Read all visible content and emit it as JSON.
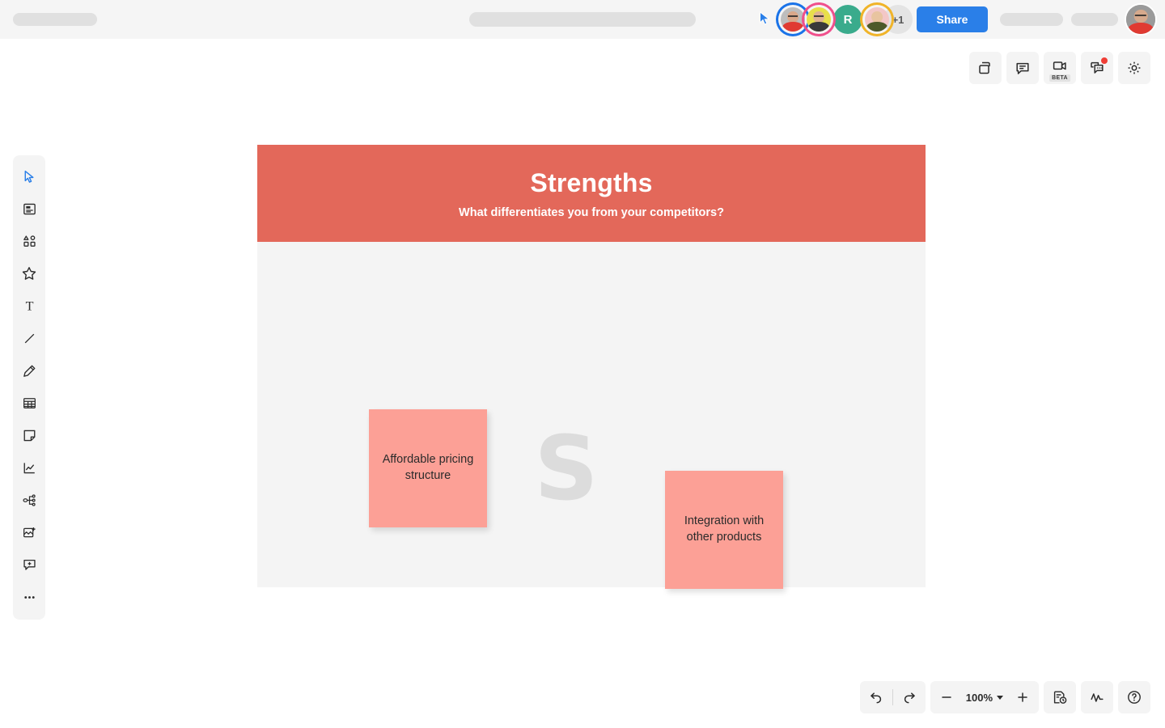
{
  "app": {
    "accent_blue": "#2a7fe8",
    "frame_header_color": "#e3685a",
    "sticky_note_color": "#fca096",
    "canvas_bg": "#f4f4f4",
    "watermark_color": "#dcdcdc"
  },
  "topbar": {
    "share_label": "Share",
    "collaborators": [
      {
        "name": "collaborator-1",
        "type": "photo",
        "ring": "#1a73e8",
        "skin": "#d9a88a",
        "shirt": "#e03a32",
        "hair": "#2b2b2b"
      },
      {
        "name": "collaborator-2",
        "type": "photo",
        "ring": "#f0508c",
        "skin": "#e0b38f",
        "shirt": "#3a3a3a",
        "hair": "#3b2a20"
      },
      {
        "name": "collaborator-3",
        "type": "initial",
        "initial": "R",
        "bg": "#3aab8c"
      },
      {
        "name": "collaborator-4",
        "type": "photo",
        "ring": "#f0b429",
        "skin": "#e8c4a0",
        "shirt": "#4d5a2a",
        "hair": "#4a3525"
      }
    ],
    "overflow_label": "+1",
    "current_user": {
      "name": "current-user-avatar",
      "skin": "#d6a98c",
      "shirt": "#e03a32",
      "bg": "#8d8d8d"
    }
  },
  "top_toolbar": [
    {
      "name": "frames-icon",
      "label": "Frames",
      "badge": null,
      "tag": null
    },
    {
      "name": "comment-icon",
      "label": "Comments",
      "badge": null,
      "tag": null
    },
    {
      "name": "video-chat-icon",
      "label": "Video chat",
      "badge": null,
      "tag": "BETA"
    },
    {
      "name": "chat-icon",
      "label": "Chat",
      "badge": "notification",
      "tag": null
    },
    {
      "name": "gear-icon",
      "label": "Settings",
      "badge": null,
      "tag": null
    }
  ],
  "sidebar": {
    "items": [
      {
        "name": "select-tool",
        "label": "Select",
        "active": true
      },
      {
        "name": "templates-tool",
        "label": "Templates",
        "active": false
      },
      {
        "name": "shapes-tool",
        "label": "Shapes",
        "active": false
      },
      {
        "name": "icons-tool",
        "label": "Icons",
        "active": false
      },
      {
        "name": "text-tool",
        "label": "Text",
        "active": false
      },
      {
        "name": "line-tool",
        "label": "Line",
        "active": false
      },
      {
        "name": "pen-tool",
        "label": "Pen",
        "active": false
      },
      {
        "name": "table-tool",
        "label": "Table",
        "active": false
      },
      {
        "name": "sticky-note-tool",
        "label": "Sticky note",
        "active": false
      },
      {
        "name": "chart-tool",
        "label": "Chart",
        "active": false
      },
      {
        "name": "mindmap-tool",
        "label": "Mind map",
        "active": false
      },
      {
        "name": "image-tool",
        "label": "Image",
        "active": false
      },
      {
        "name": "comment-tool",
        "label": "Add comment",
        "active": false
      },
      {
        "name": "more-tools",
        "label": "More",
        "active": false
      }
    ]
  },
  "frame": {
    "title": "Strengths",
    "subtitle": "What differentiates you from your competitors?",
    "watermark": "S",
    "notes": [
      {
        "name": "sticky-note-affordable-pricing",
        "text": "Affordable pricing structure"
      },
      {
        "name": "sticky-note-integration",
        "text": "Integration with other products"
      }
    ]
  },
  "bottom_toolbar": {
    "undo_label": "Undo",
    "redo_label": "Redo",
    "zoom_out_label": "−",
    "zoom_level": "100%",
    "zoom_in_label": "+",
    "history_label": "Version history",
    "activity_label": "Activity",
    "help_label": "Help"
  }
}
